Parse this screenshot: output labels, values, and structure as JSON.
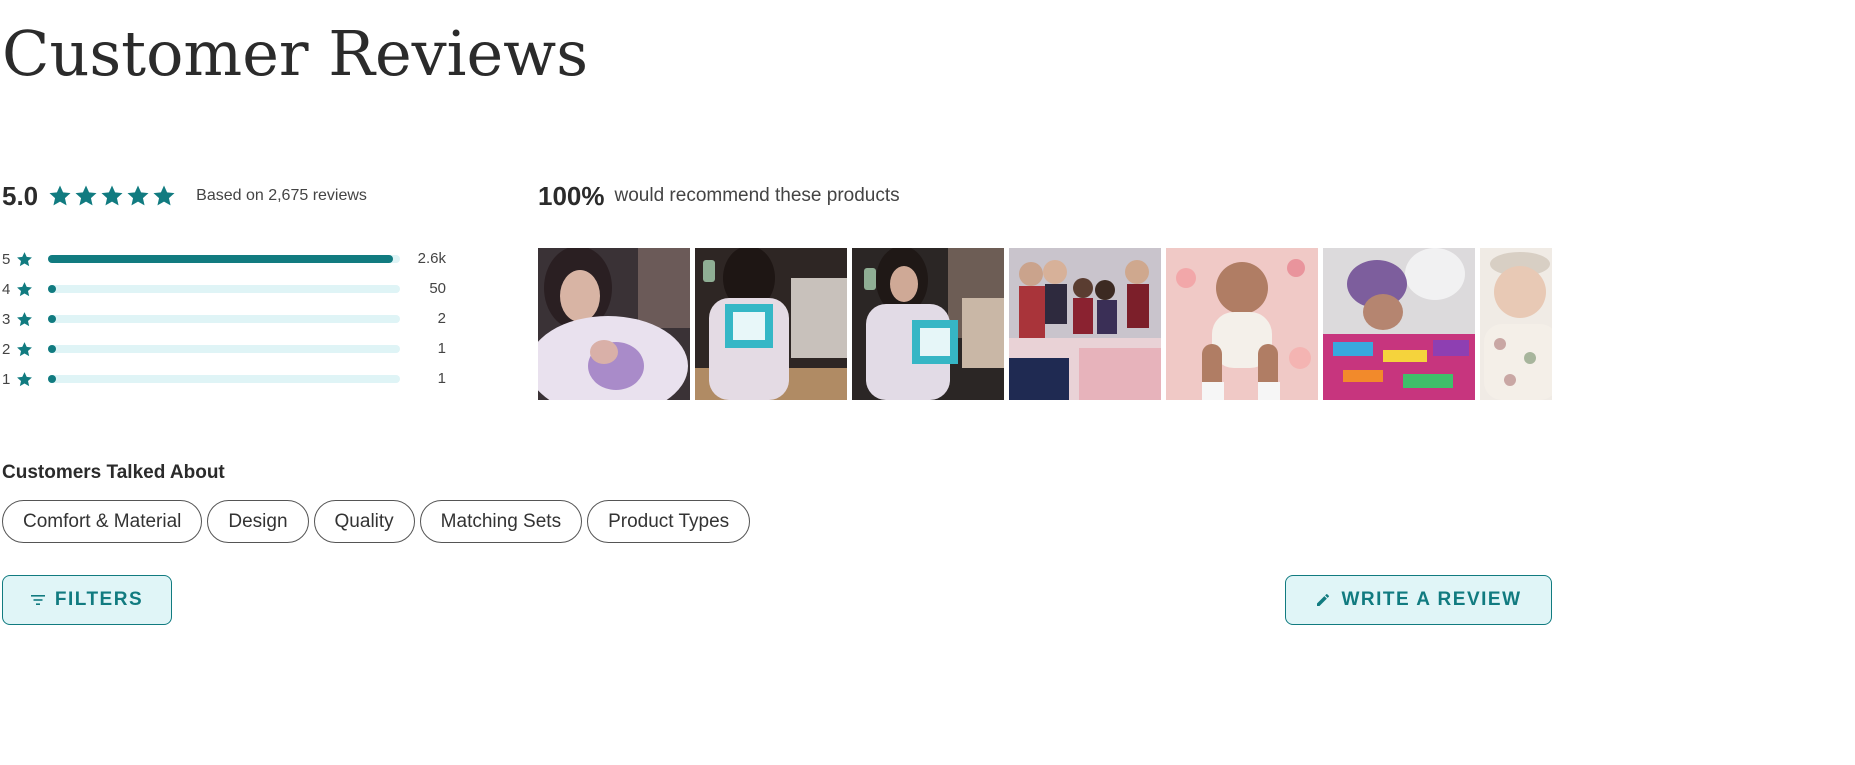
{
  "header": {
    "title": "Customer Reviews"
  },
  "summary": {
    "average": "5.0",
    "star_count": 5,
    "based_on": "Based on 2,675 reviews"
  },
  "histogram": [
    {
      "stars": "5",
      "count": "2.6k",
      "fraction": 0.98
    },
    {
      "stars": "4",
      "count": "50",
      "fraction": 0.02
    },
    {
      "stars": "3",
      "count": "2",
      "fraction": 0.01
    },
    {
      "stars": "2",
      "count": "1",
      "fraction": 0.01
    },
    {
      "stars": "1",
      "count": "1",
      "fraction": 0.01
    }
  ],
  "recommend": {
    "percent": "100%",
    "text": "would recommend these products"
  },
  "gallery": {
    "photos": [
      {
        "name": "review-photo-1"
      },
      {
        "name": "review-photo-2"
      },
      {
        "name": "review-photo-3"
      },
      {
        "name": "review-photo-4"
      },
      {
        "name": "review-photo-5"
      },
      {
        "name": "review-photo-6"
      },
      {
        "name": "review-photo-7"
      }
    ]
  },
  "topics": {
    "title": "Customers Talked About",
    "items": [
      "Comfort & Material",
      "Design",
      "Quality",
      "Matching Sets",
      "Product Types"
    ]
  },
  "actions": {
    "filters_label": "FILTERS",
    "write_label": "WRITE A REVIEW"
  },
  "colors": {
    "accent": "#117b80",
    "track": "#dff4f6",
    "button_bg": "#e0f5f7"
  },
  "icons": {
    "rating_star": "star-icon",
    "filters": "filter-lines-icon",
    "write": "pencil-icon"
  }
}
